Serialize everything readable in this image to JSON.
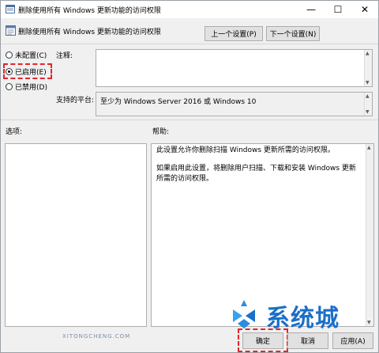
{
  "window": {
    "title": "删除使用所有 Windows 更新功能的访问权限",
    "minimize_glyph": "—",
    "maximize_glyph": "☐",
    "close_glyph": "✕"
  },
  "header": {
    "policy_title": "删除使用所有 Windows 更新功能的访问权限",
    "prev_label": "上一个设置(P)",
    "next_label": "下一个设置(N)"
  },
  "radios": {
    "not_configured": "未配置(C)",
    "enabled": "已启用(E)",
    "disabled": "已禁用(D)",
    "selected": "enabled"
  },
  "comment": {
    "label": "注释:",
    "value": ""
  },
  "platform": {
    "label": "支持的平台:",
    "value": "至少为 Windows Server 2016 或 Windows 10"
  },
  "options": {
    "label": "选项:"
  },
  "help": {
    "label": "帮助:",
    "paragraphs": [
      "此设置允许你删除扫描 Windows 更新所需的访问权限。",
      "如果启用此设置，将删除用户扫描、下载和安装 Windows 更新所需的访问权限。"
    ]
  },
  "footer": {
    "ok_label": "确定",
    "cancel_label": "取消",
    "apply_label": "应用(A)"
  },
  "watermark": {
    "text": "系统城",
    "sub": "XITONGCHENG.COM"
  },
  "colors": {
    "highlight": "#e3262a",
    "watermark": "#1a6fc9"
  },
  "icons": {
    "title": "policy-icon",
    "header": "policy-icon"
  }
}
